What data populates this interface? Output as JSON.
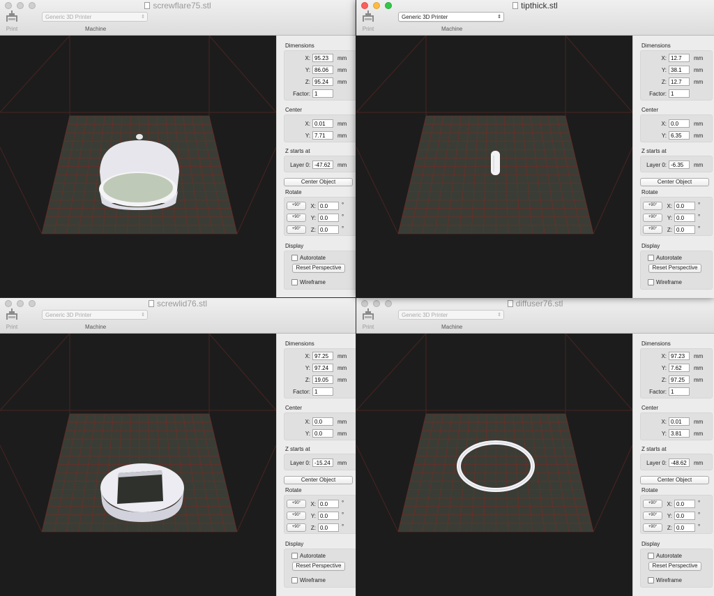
{
  "common": {
    "print_label": "Print",
    "machine_select": "Generic 3D Printer",
    "machine_label": "Machine",
    "dimensions_title": "Dimensions",
    "center_title": "Center",
    "zstarts_title": "Z starts at",
    "layer0_label": "Layer 0:",
    "center_object_label": "Center Object",
    "rotate_title": "Rotate",
    "plus90_label": "+90°",
    "display_title": "Display",
    "autorotate_label": "Autorotate",
    "reset_perspective_label": "Reset Perspective",
    "wireframe_label": "Wireframe",
    "x_label": "X:",
    "y_label": "Y:",
    "z_label": "Z:",
    "factor_label": "Factor:",
    "mm": "mm",
    "deg": "°"
  },
  "windows": [
    {
      "title": "screwflare75.stl",
      "active": false,
      "dimensions": {
        "x": "95.23",
        "y": "86.06",
        "z": "95.24",
        "factor": "1"
      },
      "center": {
        "x": "0.01",
        "y": "7.71"
      },
      "layer0": "-47.62",
      "rotate": {
        "x": "0.0",
        "y": "0.0",
        "z": "0.0"
      },
      "autorotate": false,
      "wireframe": false
    },
    {
      "title": "tipthick.stl",
      "active": true,
      "dimensions": {
        "x": "12.7",
        "y": "38.1",
        "z": "12.7",
        "factor": "1"
      },
      "center": {
        "x": "0.0",
        "y": "6.35"
      },
      "layer0": "-6.35",
      "rotate": {
        "x": "0.0",
        "y": "0.0",
        "z": "0.0"
      },
      "autorotate": false,
      "wireframe": false
    },
    {
      "title": "screwlid76.stl",
      "active": false,
      "dimensions": {
        "x": "97.25",
        "y": "97.24",
        "z": "19.05",
        "factor": "1"
      },
      "center": {
        "x": "0.0",
        "y": "0.0"
      },
      "layer0": "-15.24",
      "rotate": {
        "x": "0.0",
        "y": "0.0",
        "z": "0.0"
      },
      "autorotate": false,
      "wireframe": false
    },
    {
      "title": "diffuser76.stl",
      "active": false,
      "dimensions": {
        "x": "97.23",
        "y": "7.62",
        "z": "97.25",
        "factor": "1"
      },
      "center": {
        "x": "0.01",
        "y": "3.81"
      },
      "layer0": "-48.62",
      "rotate": {
        "x": "0.0",
        "y": "0.0",
        "z": "0.0"
      },
      "autorotate": false,
      "wireframe": false
    }
  ]
}
